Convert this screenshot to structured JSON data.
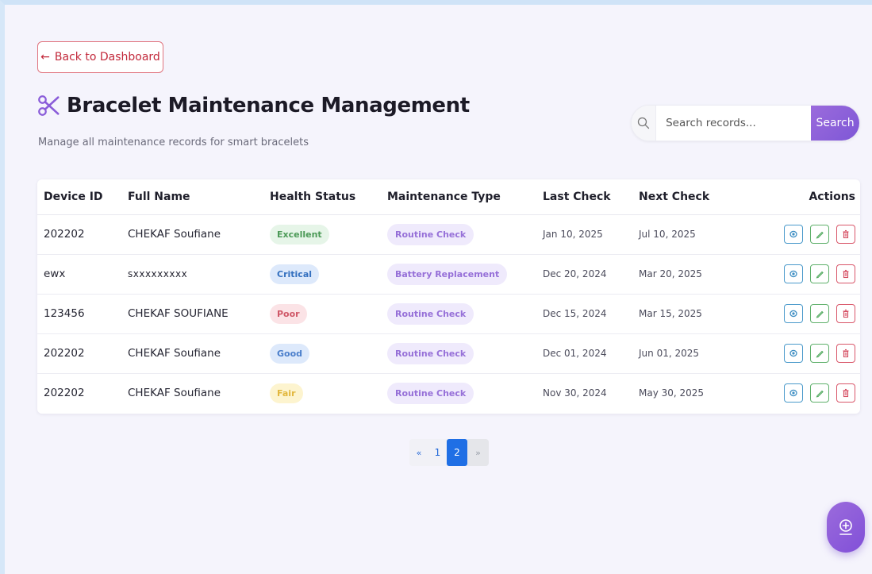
{
  "back_button": {
    "label": "Back to Dashboard"
  },
  "header": {
    "title": "Bracelet Maintenance Management",
    "subtitle": "Manage all maintenance records for smart bracelets"
  },
  "search": {
    "placeholder": "Search records...",
    "button_label": "Search"
  },
  "table": {
    "columns": [
      "Device ID",
      "Full Name",
      "Health Status",
      "Maintenance Type",
      "Last Check",
      "Next Check",
      "Actions"
    ],
    "rows": [
      {
        "device_id": "202202",
        "full_name": "CHEKAF Soufiane",
        "health_status": "Excellent",
        "maintenance_type": "Routine Check",
        "last_check": "Jan 10, 2025",
        "next_check": "Jul 10, 2025"
      },
      {
        "device_id": "ewx",
        "full_name": "sxxxxxxxxx",
        "health_status": "Critical",
        "maintenance_type": "Battery Replacement",
        "last_check": "Dec 20, 2024",
        "next_check": "Mar 20, 2025"
      },
      {
        "device_id": "123456",
        "full_name": "CHEKAF SOUFIANE",
        "health_status": "Poor",
        "maintenance_type": "Routine Check",
        "last_check": "Dec 15, 2024",
        "next_check": "Mar 15, 2025"
      },
      {
        "device_id": "202202",
        "full_name": "CHEKAF Soufiane",
        "health_status": "Good",
        "maintenance_type": "Routine Check",
        "last_check": "Dec 01, 2024",
        "next_check": "Jun 01, 2025"
      },
      {
        "device_id": "202202",
        "full_name": "CHEKAF Soufiane",
        "health_status": "Fair",
        "maintenance_type": "Routine Check",
        "last_check": "Nov 30, 2024",
        "next_check": "May 30, 2025"
      }
    ]
  },
  "pagination": {
    "prev": "«",
    "pages": [
      "1",
      "2"
    ],
    "current": "2",
    "next": "»"
  },
  "colors": {
    "accent": "#8a5cd9",
    "back": "#c2283a",
    "page_active": "#1f6fe5"
  },
  "icons": {
    "title": "scissors-icon",
    "search": "search-icon",
    "view": "eye-icon",
    "edit": "pencil-icon",
    "delete": "trash-icon",
    "fab": "plus-circle-icon"
  }
}
